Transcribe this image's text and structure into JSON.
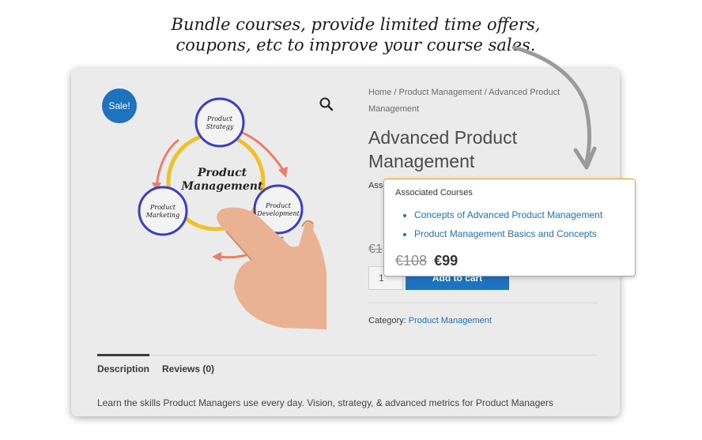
{
  "caption": {
    "line1": "Bundle courses, provide limited time offers,",
    "line2": "coupons, etc to improve your course sales."
  },
  "product": {
    "sale_badge": "Sale!",
    "breadcrumb": {
      "home": "Home",
      "sep1": " / ",
      "category": "Product Management",
      "sep2": " / ",
      "current": "Advanced Product Management"
    },
    "title": "Advanced Product Management",
    "associated_label_partial": "Assoc",
    "old_price_partial": "€1",
    "quantity": "1",
    "add_to_cart_label": "Add to cart",
    "category_label": "Category: ",
    "category_link": "Product Management",
    "image_text": {
      "center_line1": "Product",
      "center_line2": "Management",
      "strategy_line1": "Product",
      "strategy_line2": "Strategy",
      "marketing_line1": "Product",
      "marketing_line2": "Marketing",
      "development_line1": "Product",
      "development_line2": "Development"
    }
  },
  "tabs": [
    {
      "label": "Description",
      "active": true
    },
    {
      "label": "Reviews (0)",
      "active": false
    }
  ],
  "description_text": "Learn the skills Product Managers use every day. Vision, strategy, & advanced metrics for Product Managers",
  "popup": {
    "title": "Associated Courses",
    "courses": [
      "Concepts of Advanced Product Management",
      "Product Management Basics and Concepts"
    ],
    "old_price": "€108",
    "new_price": "€99"
  },
  "colors": {
    "accent_blue": "#1e73be",
    "popup_border": "#e3a53a",
    "card_bg": "#ebebeb"
  },
  "icons": [
    "search-icon",
    "curved-arrow-icon"
  ]
}
